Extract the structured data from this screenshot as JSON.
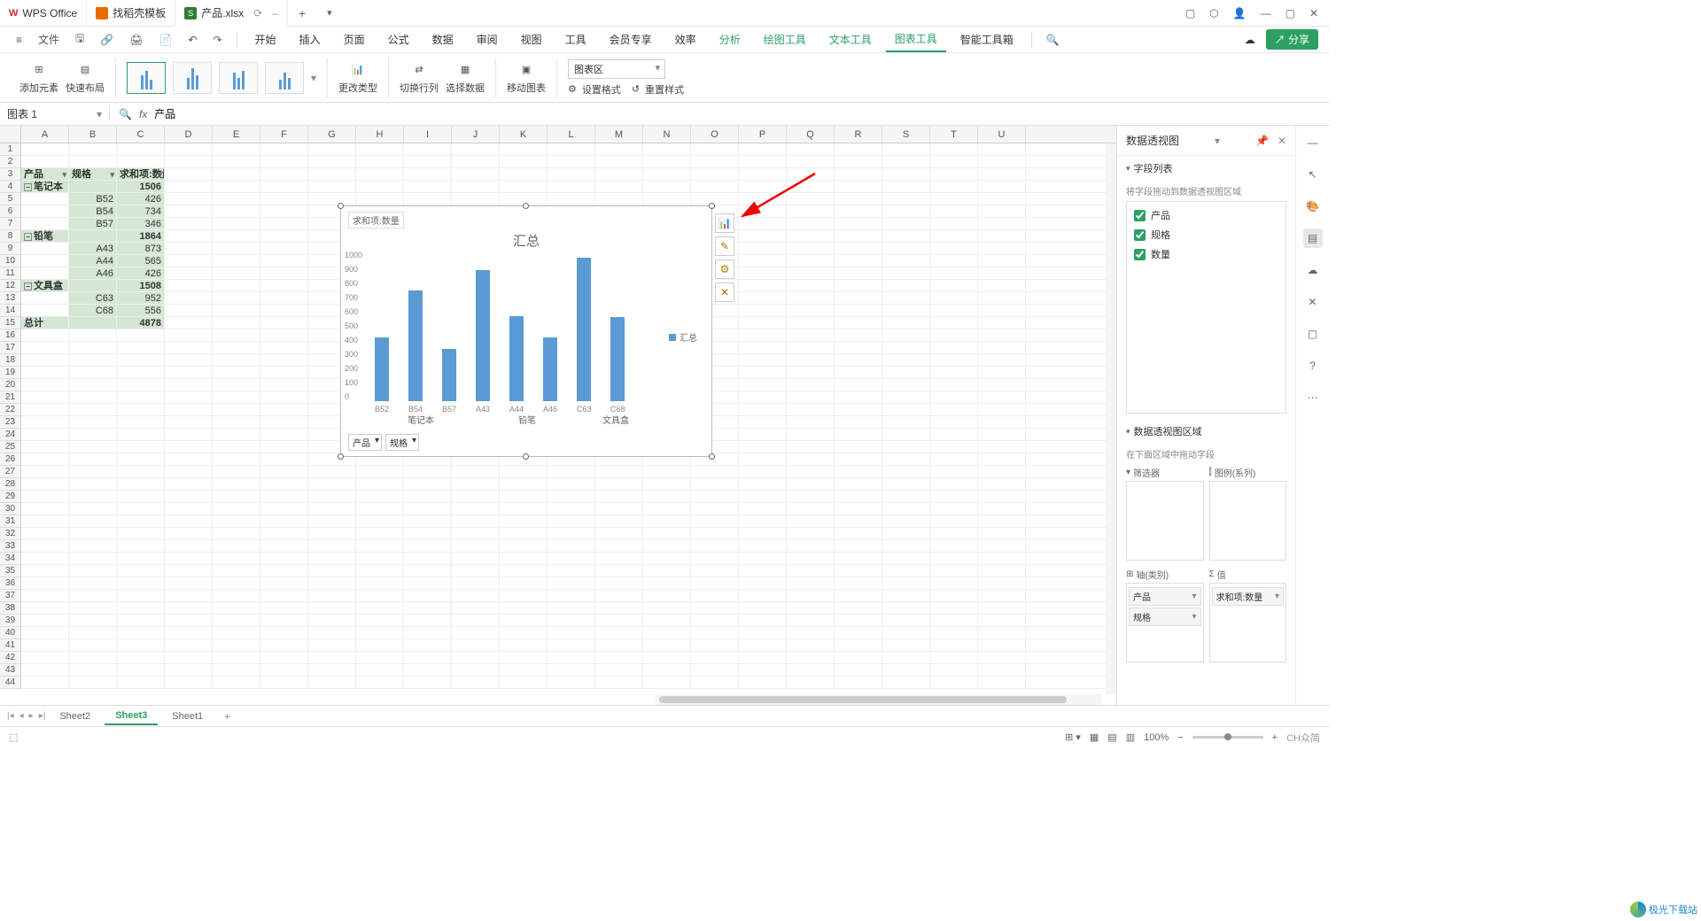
{
  "titlebar": {
    "tabs": [
      {
        "label": "WPS Office",
        "icon": "wps"
      },
      {
        "label": "找稻壳模板",
        "icon": "orange"
      },
      {
        "label": "产品.xlsx",
        "icon": "green",
        "active": true
      }
    ]
  },
  "menubar": {
    "file": "文件",
    "tabs": [
      "开始",
      "插入",
      "页面",
      "公式",
      "数据",
      "审阅",
      "视图",
      "工具",
      "会员专享",
      "效率",
      "分析",
      "绘图工具",
      "文本工具",
      "图表工具",
      "智能工具箱"
    ],
    "active_tab": "图表工具",
    "green_tabs": [
      "分析",
      "绘图工具",
      "文本工具",
      "图表工具"
    ],
    "share": "分享"
  },
  "ribbon": {
    "add_element": "添加元素",
    "quick_layout": "快速布局",
    "change_type": "更改类型",
    "switch_rc": "切换行列",
    "select_data": "选择数据",
    "move_chart": "移动图表",
    "chart_area_label": "图表区",
    "set_format": "设置格式",
    "reset_style": "重置样式"
  },
  "name_box": "图表 1",
  "formula": "产品",
  "columns": [
    "A",
    "B",
    "C",
    "D",
    "E",
    "F",
    "G",
    "H",
    "I",
    "J",
    "K",
    "L",
    "M",
    "N",
    "O",
    "P",
    "Q",
    "R",
    "S",
    "T",
    "U"
  ],
  "table": {
    "headers": [
      "产品",
      "规格",
      "求和项:数量"
    ],
    "rows": [
      {
        "r": 4,
        "a": "笔记本",
        "c": "1506",
        "expand": true,
        "bold": true
      },
      {
        "r": 5,
        "b": "B52",
        "c": "426"
      },
      {
        "r": 6,
        "b": "B54",
        "c": "734"
      },
      {
        "r": 7,
        "b": "B57",
        "c": "346"
      },
      {
        "r": 8,
        "a": "铅笔",
        "c": "1864",
        "expand": true,
        "bold": true
      },
      {
        "r": 9,
        "b": "A43",
        "c": "873"
      },
      {
        "r": 10,
        "b": "A44",
        "c": "565"
      },
      {
        "r": 11,
        "b": "A46",
        "c": "426"
      },
      {
        "r": 12,
        "a": "文具盒",
        "c": "1508",
        "expand": true,
        "bold": true
      },
      {
        "r": 13,
        "b": "C63",
        "c": "952"
      },
      {
        "r": 14,
        "b": "C68",
        "c": "556"
      },
      {
        "r": 15,
        "a": "总计",
        "c": "4878",
        "bold": true
      }
    ]
  },
  "chart_data": {
    "type": "bar",
    "title": "汇总",
    "value_field_label": "求和项:数量",
    "legend": "汇总",
    "categories": [
      "B52",
      "B54",
      "B57",
      "A43",
      "A44",
      "A46",
      "C63",
      "C68"
    ],
    "groups": [
      {
        "label": "笔记本",
        "span": 3
      },
      {
        "label": "铅笔",
        "span": 3
      },
      {
        "label": "文具盒",
        "span": 2
      }
    ],
    "values": [
      426,
      734,
      346,
      873,
      565,
      426,
      952,
      556
    ],
    "ylim": [
      0,
      1000
    ],
    "yticks": [
      0,
      100,
      200,
      300,
      400,
      500,
      600,
      700,
      800,
      900,
      1000
    ],
    "filters": [
      "产品",
      "规格"
    ]
  },
  "right_panel": {
    "title": "数据透视图",
    "field_list_title": "字段列表",
    "field_hint": "将字段拖动到数据透视图区域",
    "fields": [
      "产品",
      "规格",
      "数量"
    ],
    "area_title": "数据透视图区域",
    "area_hint": "在下面区域中拖动字段",
    "filter_label": "筛选器",
    "legend_label": "图例(系列)",
    "axis_label": "轴(类别)",
    "values_label": "值",
    "axis_items": [
      "产品",
      "规格"
    ],
    "values_items": [
      "求和项:数量"
    ]
  },
  "sheets": {
    "tabs": [
      "Sheet2",
      "Sheet3",
      "Sheet1"
    ],
    "active": "Sheet3"
  },
  "status": {
    "zoom": "100%",
    "ch_label": "CH众简"
  },
  "watermark": "极光下载站"
}
